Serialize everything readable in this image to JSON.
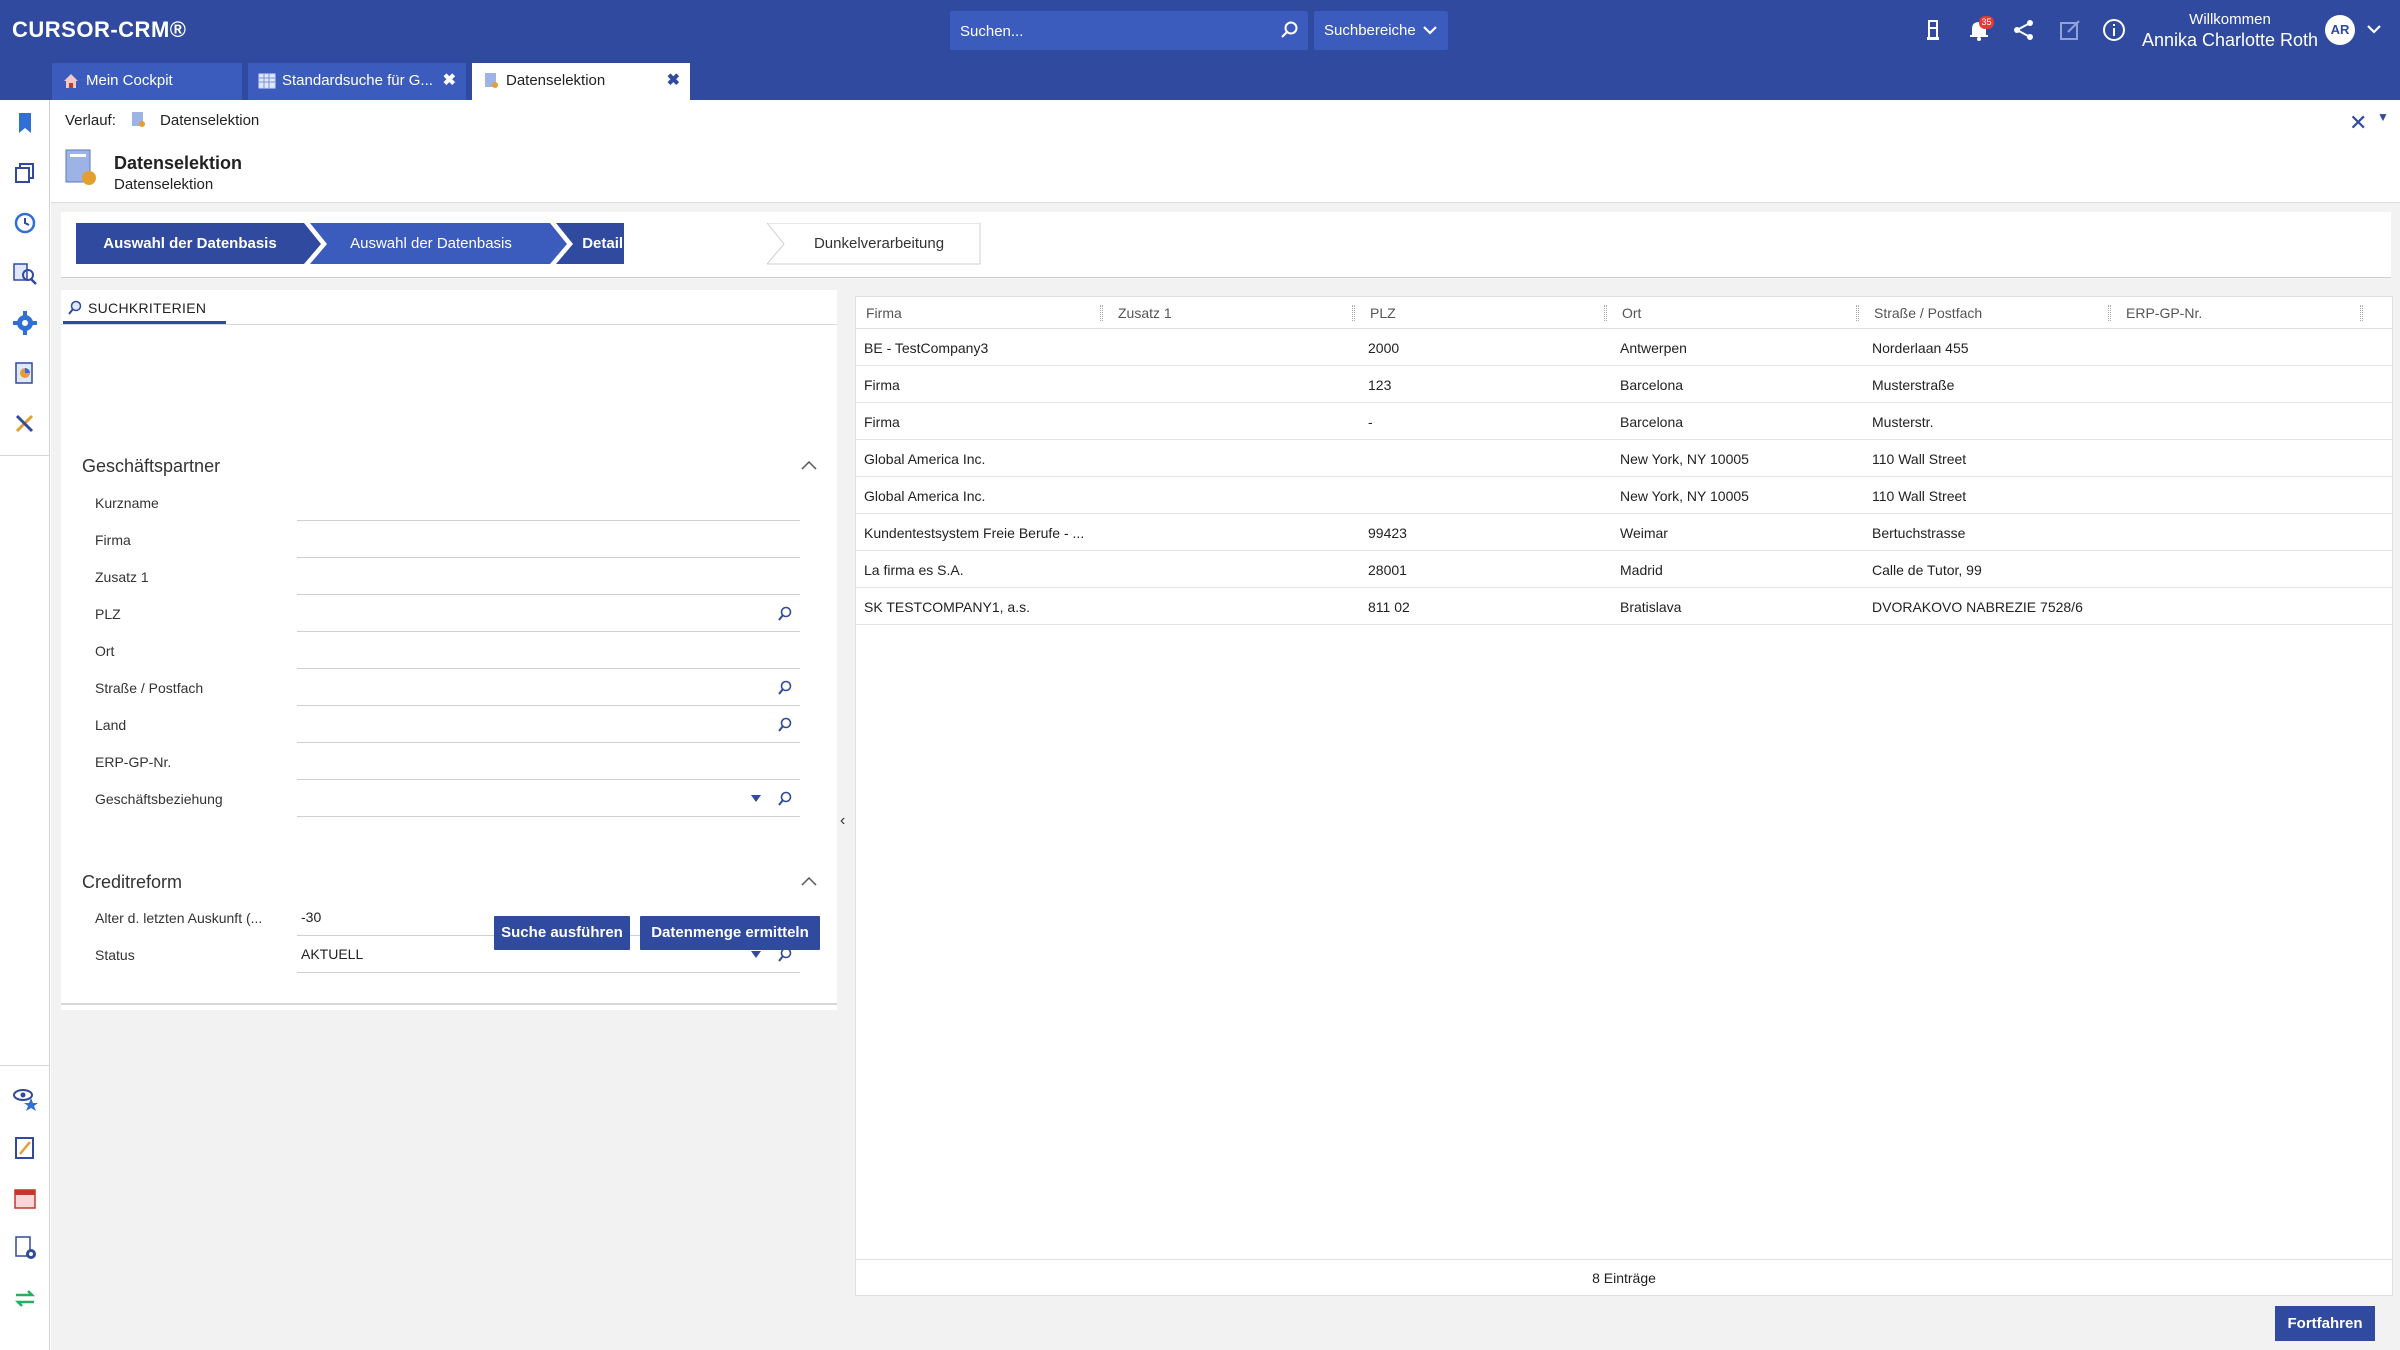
{
  "app": {
    "logo": "CURSOR-CRM®",
    "search_placeholder": "Suchen...",
    "search_areas": "Suchbereiche",
    "welcome": "Willkommen",
    "user_name": "Annika Charlotte Roth",
    "avatar_initials": "AR",
    "notification_count": "35",
    "brand_color": "#2f4a9e"
  },
  "tabs": [
    {
      "label": "Mein Cockpit",
      "icon": "home-icon"
    },
    {
      "label": "Standardsuche für G...",
      "icon": "table-icon"
    },
    {
      "label": "Datenselektion",
      "icon": "document-icon"
    }
  ],
  "header": {
    "verlauf_label": "Verlauf:",
    "verlauf_item": "Datenselektion",
    "title": "Datenselektion",
    "subtitle": "Datenselektion"
  },
  "wizard": {
    "steps": [
      "Auswahl der Datenbasis",
      "Auswahl der Datenbasis",
      "Detaillierung der Suche",
      "Dunkelverarbeitung"
    ]
  },
  "search_panel": {
    "tab_label": "SUCHKRITERIEN",
    "section1": {
      "title": "Geschäftspartner",
      "fields": [
        {
          "label": "Kurzname",
          "value": ""
        },
        {
          "label": "Firma",
          "value": ""
        },
        {
          "label": "Zusatz 1",
          "value": ""
        },
        {
          "label": "PLZ",
          "value": ""
        },
        {
          "label": "Ort",
          "value": ""
        },
        {
          "label": "Straße / Postfach",
          "value": ""
        },
        {
          "label": "Land",
          "value": ""
        },
        {
          "label": "ERP-GP-Nr.",
          "value": ""
        },
        {
          "label": "Geschäftsbeziehung",
          "value": ""
        }
      ]
    },
    "section2": {
      "title": "Creditreform",
      "fields": [
        {
          "label": "Alter d. letzten Auskunft (...",
          "value": "-30"
        },
        {
          "label": "Status",
          "value": "AKTUELL"
        }
      ]
    },
    "buttons": {
      "search": "Suche ausführen",
      "count": "Datenmenge ermitteln"
    }
  },
  "results": {
    "columns": [
      "Firma",
      "Zusatz 1",
      "PLZ",
      "Ort",
      "Straße / Postfach",
      "ERP-GP-Nr."
    ],
    "rows": [
      [
        "BE - TestCompany3",
        "",
        "2000",
        "Antwerpen",
        "Norderlaan 455",
        ""
      ],
      [
        "Firma",
        "",
        "123",
        "Barcelona",
        "Musterstraße",
        ""
      ],
      [
        "Firma",
        "",
        "-",
        "Barcelona",
        "Musterstr.",
        ""
      ],
      [
        "Global America Inc.",
        "",
        "",
        "New York, NY 10005",
        "110 Wall Street",
        ""
      ],
      [
        "Global America Inc.",
        "",
        "",
        "New York, NY 10005",
        "110 Wall Street",
        ""
      ],
      [
        "Kundentestsystem Freie Berufe - ...",
        "",
        "99423",
        "Weimar",
        "Bertuchstrasse",
        ""
      ],
      [
        "La firma es S.A.",
        "",
        "28001",
        "Madrid",
        "Calle de Tutor, 99",
        ""
      ],
      [
        "SK TESTCOMPANY1, a.s.",
        "",
        "811 02",
        "Bratislava",
        "DVORAKOVO NABREZIE 7528/6",
        ""
      ]
    ],
    "footer": "8 Einträge"
  },
  "actions": {
    "continue": "Fortfahren"
  }
}
